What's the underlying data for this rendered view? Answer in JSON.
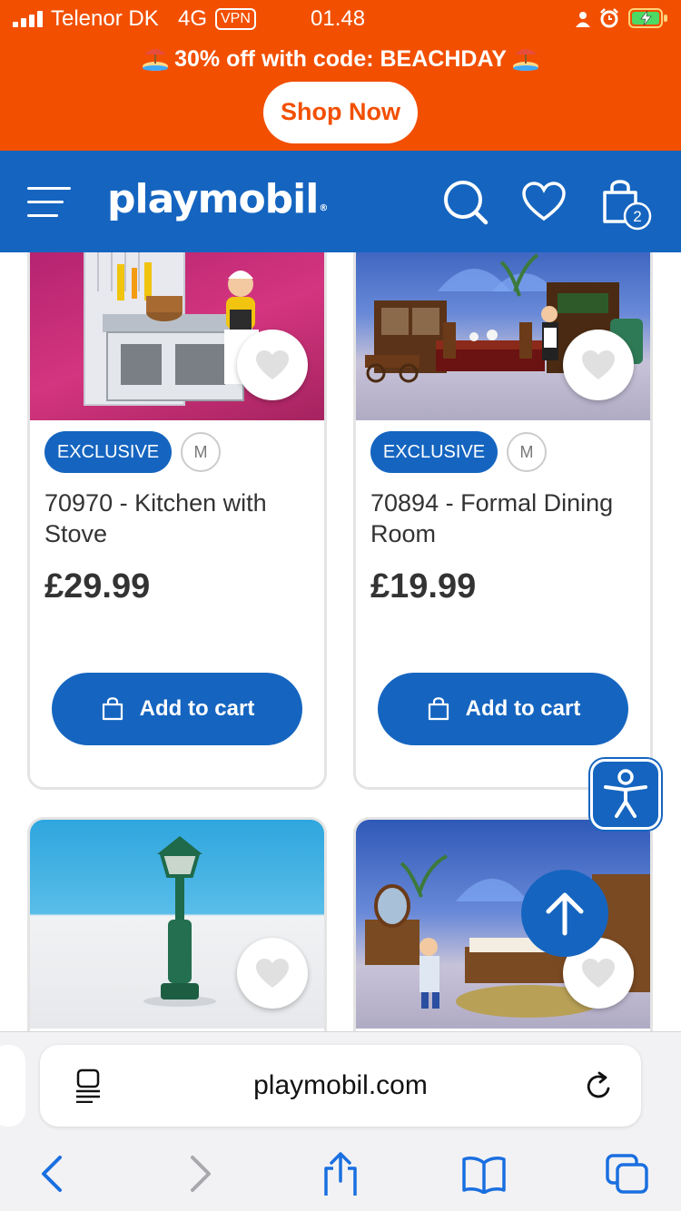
{
  "status_bar": {
    "carrier": "Telenor DK",
    "network": "4G",
    "vpn": "VPN",
    "time": "01.48"
  },
  "promo": {
    "text": "30% off with code: BEACHDAY",
    "button": "Shop Now"
  },
  "header": {
    "logo": "playmobil",
    "cart_count": "2"
  },
  "products": [
    {
      "badge": "EXCLUSIVE",
      "age_badge": "M",
      "title": "70970 - Kitchen with Stove",
      "price": "£29.99",
      "button": "Add to cart"
    },
    {
      "badge": "EXCLUSIVE",
      "age_badge": "M",
      "title": "70894 - Formal Dining Room",
      "price": "£19.99",
      "button": "Add to cart"
    }
  ],
  "browser": {
    "url": "playmobil.com"
  },
  "colors": {
    "brand_blue": "#1565c0",
    "promo_orange": "#f24f00"
  }
}
